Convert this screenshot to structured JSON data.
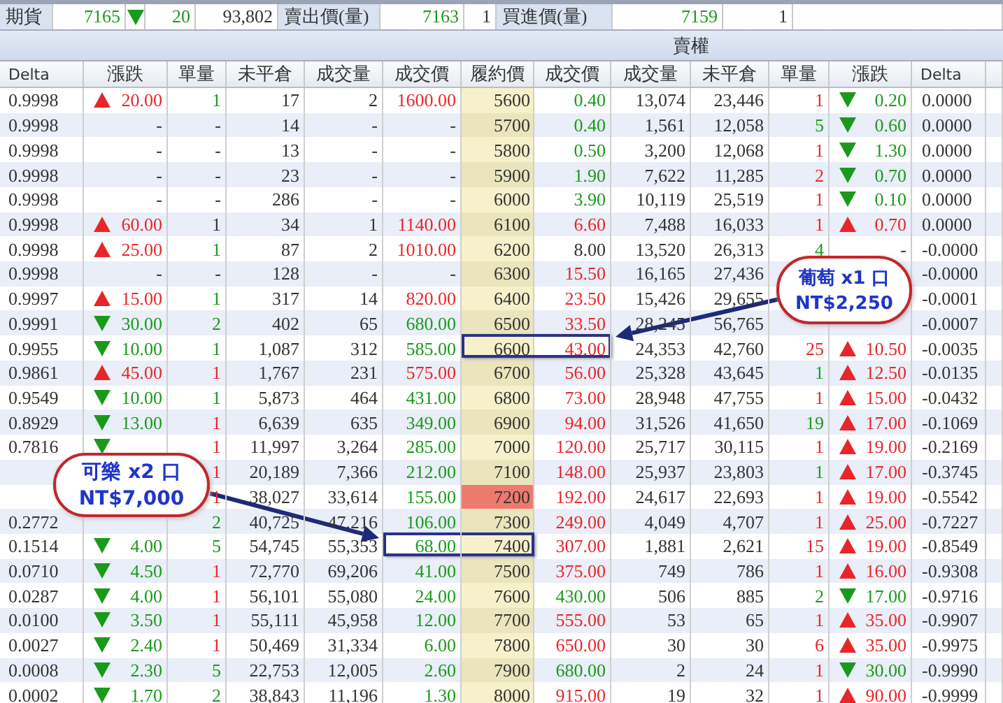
{
  "quote_bar": {
    "futures": {
      "label": "期貨",
      "price": {
        "text": "7165",
        "color": "#1a9a1a"
      },
      "change": {
        "kind": "down",
        "text": "20",
        "color": "#1a9a1a"
      },
      "volume": "93,802"
    },
    "ask": {
      "label": "賣出價(量)",
      "price": {
        "text": "7163",
        "color": "#1a9a1a"
      },
      "qty": "1"
    },
    "bid": {
      "label": "買進價(量)",
      "price": {
        "text": "7159",
        "color": "#1a9a1a"
      },
      "qty": "1"
    }
  },
  "section_header": "賣權",
  "columns": [
    "Delta",
    "漲跌",
    "單量",
    "未平倉",
    "成交量",
    "成交價",
    "履約價",
    "成交價",
    "成交量",
    "未平倉",
    "單量",
    "漲跌",
    "Delta"
  ],
  "rows": [
    {
      "strike": {
        "text": "5600",
        "atm": false
      },
      "call": {
        "delta": "0.9998",
        "change": {
          "kind": "up",
          "text": "20.00",
          "color": "#e8262a"
        },
        "qty": {
          "text": "1",
          "color": "#1a9a1a"
        },
        "oi": "17",
        "volume": "2",
        "price": {
          "text": "1600.00",
          "color": "#e8262a",
          "outlined": false
        }
      },
      "put": {
        "price": {
          "text": "0.40",
          "color": "#1a9a1a",
          "outlined": false
        },
        "volume": "13,074",
        "oi": "23,446",
        "qty": {
          "text": "1",
          "color": "#e8262a"
        },
        "change": {
          "kind": "down",
          "text": "0.20",
          "color": "#1a9a1a"
        },
        "delta": "0.0000"
      }
    },
    {
      "strike": {
        "text": "5700",
        "atm": false
      },
      "call": {
        "delta": "0.9998",
        "change": {
          "kind": "none",
          "text": "-",
          "color": "#333333"
        },
        "qty": {
          "text": "-",
          "color": "#333333"
        },
        "oi": "14",
        "volume": "-",
        "price": {
          "text": "-",
          "color": "#333333",
          "outlined": false
        }
      },
      "put": {
        "price": {
          "text": "0.40",
          "color": "#1a9a1a",
          "outlined": false
        },
        "volume": "1,561",
        "oi": "12,058",
        "qty": {
          "text": "5",
          "color": "#1a9a1a"
        },
        "change": {
          "kind": "down",
          "text": "0.60",
          "color": "#1a9a1a"
        },
        "delta": "0.0000"
      }
    },
    {
      "strike": {
        "text": "5800",
        "atm": false
      },
      "call": {
        "delta": "0.9998",
        "change": {
          "kind": "none",
          "text": "-",
          "color": "#333333"
        },
        "qty": {
          "text": "-",
          "color": "#333333"
        },
        "oi": "13",
        "volume": "-",
        "price": {
          "text": "-",
          "color": "#333333",
          "outlined": false
        }
      },
      "put": {
        "price": {
          "text": "0.50",
          "color": "#1a9a1a",
          "outlined": false
        },
        "volume": "3,200",
        "oi": "12,068",
        "qty": {
          "text": "1",
          "color": "#e8262a"
        },
        "change": {
          "kind": "down",
          "text": "1.30",
          "color": "#1a9a1a"
        },
        "delta": "0.0000"
      }
    },
    {
      "strike": {
        "text": "5900",
        "atm": false
      },
      "call": {
        "delta": "0.9998",
        "change": {
          "kind": "none",
          "text": "-",
          "color": "#333333"
        },
        "qty": {
          "text": "-",
          "color": "#333333"
        },
        "oi": "23",
        "volume": "-",
        "price": {
          "text": "-",
          "color": "#333333",
          "outlined": false
        }
      },
      "put": {
        "price": {
          "text": "1.90",
          "color": "#1a9a1a",
          "outlined": false
        },
        "volume": "7,622",
        "oi": "11,285",
        "qty": {
          "text": "2",
          "color": "#e8262a"
        },
        "change": {
          "kind": "down",
          "text": "0.70",
          "color": "#1a9a1a"
        },
        "delta": "0.0000"
      }
    },
    {
      "strike": {
        "text": "6000",
        "atm": false
      },
      "call": {
        "delta": "0.9998",
        "change": {
          "kind": "none",
          "text": "-",
          "color": "#333333"
        },
        "qty": {
          "text": "-",
          "color": "#333333"
        },
        "oi": "286",
        "volume": "-",
        "price": {
          "text": "-",
          "color": "#333333",
          "outlined": false
        }
      },
      "put": {
        "price": {
          "text": "3.90",
          "color": "#1a9a1a",
          "outlined": false
        },
        "volume": "10,119",
        "oi": "25,519",
        "qty": {
          "text": "1",
          "color": "#e8262a"
        },
        "change": {
          "kind": "down",
          "text": "0.10",
          "color": "#1a9a1a"
        },
        "delta": "0.0000"
      }
    },
    {
      "strike": {
        "text": "6100",
        "atm": false
      },
      "call": {
        "delta": "0.9998",
        "change": {
          "kind": "up",
          "text": "60.00",
          "color": "#e8262a"
        },
        "qty": {
          "text": "1",
          "color": "#333333"
        },
        "oi": "34",
        "volume": "1",
        "price": {
          "text": "1140.00",
          "color": "#e8262a",
          "outlined": false
        }
      },
      "put": {
        "price": {
          "text": "6.60",
          "color": "#e8262a",
          "outlined": false
        },
        "volume": "7,488",
        "oi": "16,033",
        "qty": {
          "text": "1",
          "color": "#e8262a"
        },
        "change": {
          "kind": "up",
          "text": "0.70",
          "color": "#e8262a"
        },
        "delta": "0.0000"
      }
    },
    {
      "strike": {
        "text": "6200",
        "atm": false
      },
      "call": {
        "delta": "0.9998",
        "change": {
          "kind": "up",
          "text": "25.00",
          "color": "#e8262a"
        },
        "qty": {
          "text": "1",
          "color": "#1a9a1a"
        },
        "oi": "87",
        "volume": "2",
        "price": {
          "text": "1010.00",
          "color": "#e8262a",
          "outlined": false
        }
      },
      "put": {
        "price": {
          "text": "8.00",
          "color": "#333333",
          "outlined": false
        },
        "volume": "13,520",
        "oi": "26,313",
        "qty": {
          "text": "4",
          "color": "#1a9a1a"
        },
        "change": {
          "kind": "none",
          "text": "-",
          "color": "#333333"
        },
        "delta": "-0.0000"
      }
    },
    {
      "strike": {
        "text": "6300",
        "atm": false
      },
      "call": {
        "delta": "0.9998",
        "change": {
          "kind": "none",
          "text": "-",
          "color": "#333333"
        },
        "qty": {
          "text": "-",
          "color": "#333333"
        },
        "oi": "128",
        "volume": "-",
        "price": {
          "text": "-",
          "color": "#333333",
          "outlined": false
        }
      },
      "put": {
        "price": {
          "text": "15.50",
          "color": "#e8262a",
          "outlined": false
        },
        "volume": "16,165",
        "oi": "27,436",
        "delta": "-0.0000"
      }
    },
    {
      "strike": {
        "text": "6400",
        "atm": false
      },
      "call": {
        "delta": "0.9997",
        "change": {
          "kind": "up",
          "text": "15.00",
          "color": "#e8262a"
        },
        "qty": {
          "text": "1",
          "color": "#1a9a1a"
        },
        "oi": "317",
        "volume": "14",
        "price": {
          "text": "820.00",
          "color": "#e8262a",
          "outlined": false
        }
      },
      "put": {
        "price": {
          "text": "23.50",
          "color": "#e8262a",
          "outlined": false
        },
        "volume": "15,426",
        "oi": "29,655",
        "delta": "-0.0001"
      }
    },
    {
      "strike": {
        "text": "6500",
        "atm": false
      },
      "call": {
        "delta": "0.9991",
        "change": {
          "kind": "down",
          "text": "30.00",
          "color": "#1a9a1a"
        },
        "qty": {
          "text": "2",
          "color": "#1a9a1a"
        },
        "oi": "402",
        "volume": "65",
        "price": {
          "text": "680.00",
          "color": "#1a9a1a",
          "outlined": false
        }
      },
      "put": {
        "price": {
          "text": "33.50",
          "color": "#e8262a",
          "outlined": false
        },
        "volume": "28,245",
        "oi": "56,765",
        "delta": "-0.0007"
      }
    },
    {
      "strike": {
        "text": "6600",
        "atm": false
      },
      "call": {
        "delta": "0.9955",
        "change": {
          "kind": "down",
          "text": "10.00",
          "color": "#1a9a1a"
        },
        "qty": {
          "text": "1",
          "color": "#1a9a1a"
        },
        "oi": "1,087",
        "volume": "312",
        "price": {
          "text": "585.00",
          "color": "#1a9a1a",
          "outlined": false
        }
      },
      "put": {
        "price": {
          "text": "43.00",
          "color": "#e8262a",
          "outlined": true
        },
        "volume": "24,353",
        "oi": "42,760",
        "qty": {
          "text": "25",
          "color": "#e8262a"
        },
        "change": {
          "kind": "up",
          "text": "10.50",
          "color": "#e8262a"
        },
        "delta": "-0.0035"
      }
    },
    {
      "strike": {
        "text": "6700",
        "atm": false
      },
      "call": {
        "delta": "0.9861",
        "change": {
          "kind": "up",
          "text": "45.00",
          "color": "#e8262a"
        },
        "qty": {
          "text": "1",
          "color": "#e8262a"
        },
        "oi": "1,767",
        "volume": "231",
        "price": {
          "text": "575.00",
          "color": "#e8262a",
          "outlined": false
        }
      },
      "put": {
        "price": {
          "text": "56.00",
          "color": "#e8262a",
          "outlined": false
        },
        "volume": "25,328",
        "oi": "43,645",
        "qty": {
          "text": "1",
          "color": "#1a9a1a"
        },
        "change": {
          "kind": "up",
          "text": "12.50",
          "color": "#e8262a"
        },
        "delta": "-0.0135"
      }
    },
    {
      "strike": {
        "text": "6800",
        "atm": false
      },
      "call": {
        "delta": "0.9549",
        "change": {
          "kind": "down",
          "text": "10.00",
          "color": "#1a9a1a"
        },
        "qty": {
          "text": "1",
          "color": "#1a9a1a"
        },
        "oi": "5,873",
        "volume": "464",
        "price": {
          "text": "431.00",
          "color": "#1a9a1a",
          "outlined": false
        }
      },
      "put": {
        "price": {
          "text": "73.00",
          "color": "#e8262a",
          "outlined": false
        },
        "volume": "28,948",
        "oi": "47,755",
        "qty": {
          "text": "1",
          "color": "#e8262a"
        },
        "change": {
          "kind": "up",
          "text": "15.00",
          "color": "#e8262a"
        },
        "delta": "-0.0432"
      }
    },
    {
      "strike": {
        "text": "6900",
        "atm": false
      },
      "call": {
        "delta": "0.8929",
        "change": {
          "kind": "down",
          "text": "13.00",
          "color": "#1a9a1a"
        },
        "qty": {
          "text": "1",
          "color": "#e8262a"
        },
        "oi": "6,639",
        "volume": "635",
        "price": {
          "text": "349.00",
          "color": "#1a9a1a",
          "outlined": false
        }
      },
      "put": {
        "price": {
          "text": "94.00",
          "color": "#e8262a",
          "outlined": false
        },
        "volume": "31,526",
        "oi": "41,650",
        "qty": {
          "text": "19",
          "color": "#1a9a1a"
        },
        "change": {
          "kind": "up",
          "text": "17.00",
          "color": "#e8262a"
        },
        "delta": "-0.1069"
      }
    },
    {
      "strike": {
        "text": "7000",
        "atm": false
      },
      "call": {
        "delta": "0.7816",
        "change": {
          "kind": "down",
          "color": "#1a9a1a"
        },
        "qty": {
          "text": "1",
          "color": "#e8262a"
        },
        "oi": "11,997",
        "volume": "3,264",
        "price": {
          "text": "285.00",
          "color": "#1a9a1a",
          "outlined": false
        }
      },
      "put": {
        "price": {
          "text": "120.00",
          "color": "#e8262a",
          "outlined": false
        },
        "volume": "25,717",
        "oi": "30,115",
        "qty": {
          "text": "1",
          "color": "#e8262a"
        },
        "change": {
          "kind": "up",
          "text": "19.00",
          "color": "#e8262a"
        },
        "delta": "-0.2169"
      }
    },
    {
      "strike": {
        "text": "7100",
        "atm": false
      },
      "call": {
        "qty": {
          "text": "1",
          "color": "#e8262a"
        },
        "oi": "20,189",
        "volume": "7,366",
        "price": {
          "text": "212.00",
          "color": "#1a9a1a",
          "outlined": false
        }
      },
      "put": {
        "price": {
          "text": "148.00",
          "color": "#e8262a",
          "outlined": false
        },
        "volume": "25,937",
        "oi": "23,803",
        "qty": {
          "text": "1",
          "color": "#1a9a1a"
        },
        "change": {
          "kind": "up",
          "text": "17.00",
          "color": "#e8262a"
        },
        "delta": "-0.3745"
      }
    },
    {
      "strike": {
        "text": "7200",
        "atm": true
      },
      "call": {
        "qty": {
          "text": "1",
          "color": "#e8262a"
        },
        "oi": "38,027",
        "volume": "33,614",
        "price": {
          "text": "155.00",
          "color": "#1a9a1a",
          "outlined": false
        }
      },
      "put": {
        "price": {
          "text": "192.00",
          "color": "#e8262a",
          "outlined": false
        },
        "volume": "24,617",
        "oi": "22,693",
        "qty": {
          "text": "1",
          "color": "#e8262a"
        },
        "change": {
          "kind": "up",
          "text": "19.00",
          "color": "#e8262a"
        },
        "delta": "-0.5542"
      }
    },
    {
      "strike": {
        "text": "7300",
        "atm": false
      },
      "call": {
        "delta": "0.2772",
        "qty": {
          "text": "2",
          "color": "#1a9a1a"
        },
        "oi": "40,725",
        "volume": "47,216",
        "price": {
          "text": "106.00",
          "color": "#1a9a1a",
          "outlined": false
        }
      },
      "put": {
        "price": {
          "text": "249.00",
          "color": "#e8262a",
          "outlined": false
        },
        "volume": "4,049",
        "oi": "4,707",
        "qty": {
          "text": "1",
          "color": "#e8262a"
        },
        "change": {
          "kind": "up",
          "text": "25.00",
          "color": "#e8262a"
        },
        "delta": "-0.7227"
      }
    },
    {
      "strike": {
        "text": "7400",
        "atm": false
      },
      "call": {
        "delta": "0.1514",
        "change": {
          "kind": "down",
          "text": "4.00",
          "color": "#1a9a1a"
        },
        "qty": {
          "text": "5",
          "color": "#1a9a1a"
        },
        "oi": "54,745",
        "volume": "55,353",
        "price": {
          "text": "68.00",
          "color": "#1a9a1a",
          "outlined": true
        }
      },
      "put": {
        "price": {
          "text": "307.00",
          "color": "#e8262a",
          "outlined": false
        },
        "volume": "1,881",
        "oi": "2,621",
        "qty": {
          "text": "15",
          "color": "#e8262a"
        },
        "change": {
          "kind": "up",
          "text": "19.00",
          "color": "#e8262a"
        },
        "delta": "-0.8549"
      }
    },
    {
      "strike": {
        "text": "7500",
        "atm": false
      },
      "call": {
        "delta": "0.0710",
        "change": {
          "kind": "down",
          "text": "4.50",
          "color": "#1a9a1a"
        },
        "qty": {
          "text": "1",
          "color": "#e8262a"
        },
        "oi": "72,770",
        "volume": "69,206",
        "price": {
          "text": "41.00",
          "color": "#1a9a1a",
          "outlined": false
        }
      },
      "put": {
        "price": {
          "text": "375.00",
          "color": "#e8262a",
          "outlined": false
        },
        "volume": "749",
        "oi": "786",
        "qty": {
          "text": "1",
          "color": "#e8262a"
        },
        "change": {
          "kind": "up",
          "text": "16.00",
          "color": "#e8262a"
        },
        "delta": "-0.9308"
      }
    },
    {
      "strike": {
        "text": "7600",
        "atm": false
      },
      "call": {
        "delta": "0.0287",
        "change": {
          "kind": "down",
          "text": "4.00",
          "color": "#1a9a1a"
        },
        "qty": {
          "text": "1",
          "color": "#e8262a"
        },
        "oi": "56,101",
        "volume": "55,080",
        "price": {
          "text": "24.00",
          "color": "#1a9a1a",
          "outlined": false
        }
      },
      "put": {
        "price": {
          "text": "430.00",
          "color": "#1a9a1a",
          "outlined": false
        },
        "volume": "506",
        "oi": "885",
        "qty": {
          "text": "2",
          "color": "#1a9a1a"
        },
        "change": {
          "kind": "down",
          "text": "17.00",
          "color": "#1a9a1a"
        },
        "delta": "-0.9716"
      }
    },
    {
      "strike": {
        "text": "7700",
        "atm": false
      },
      "call": {
        "delta": "0.0100",
        "change": {
          "kind": "down",
          "text": "3.50",
          "color": "#1a9a1a"
        },
        "qty": {
          "text": "1",
          "color": "#e8262a"
        },
        "oi": "55,111",
        "volume": "45,958",
        "price": {
          "text": "12.00",
          "color": "#1a9a1a",
          "outlined": false
        }
      },
      "put": {
        "price": {
          "text": "555.00",
          "color": "#e8262a",
          "outlined": false
        },
        "volume": "53",
        "oi": "65",
        "qty": {
          "text": "1",
          "color": "#e8262a"
        },
        "change": {
          "kind": "up",
          "text": "35.00",
          "color": "#e8262a"
        },
        "delta": "-0.9907"
      }
    },
    {
      "strike": {
        "text": "7800",
        "atm": false
      },
      "call": {
        "delta": "0.0027",
        "change": {
          "kind": "down",
          "text": "2.40",
          "color": "#1a9a1a"
        },
        "qty": {
          "text": "1",
          "color": "#e8262a"
        },
        "oi": "50,469",
        "volume": "31,334",
        "price": {
          "text": "6.00",
          "color": "#1a9a1a",
          "outlined": false
        }
      },
      "put": {
        "price": {
          "text": "650.00",
          "color": "#e8262a",
          "outlined": false
        },
        "volume": "30",
        "oi": "30",
        "qty": {
          "text": "6",
          "color": "#e8262a"
        },
        "change": {
          "kind": "up",
          "text": "35.00",
          "color": "#e8262a"
        },
        "delta": "-0.9975"
      }
    },
    {
      "strike": {
        "text": "7900",
        "atm": false
      },
      "call": {
        "delta": "0.0008",
        "change": {
          "kind": "down",
          "text": "2.30",
          "color": "#1a9a1a"
        },
        "qty": {
          "text": "5",
          "color": "#1a9a1a"
        },
        "oi": "22,753",
        "volume": "12,005",
        "price": {
          "text": "2.60",
          "color": "#1a9a1a",
          "outlined": false
        }
      },
      "put": {
        "price": {
          "text": "680.00",
          "color": "#1a9a1a",
          "outlined": false
        },
        "volume": "2",
        "oi": "24",
        "qty": {
          "text": "1",
          "color": "#e8262a"
        },
        "change": {
          "kind": "down",
          "text": "30.00",
          "color": "#1a9a1a"
        },
        "delta": "-0.9990"
      }
    },
    {
      "strike": {
        "text": "8000",
        "atm": false
      },
      "call": {
        "delta": "0.0002",
        "change": {
          "kind": "down",
          "text": "1.70",
          "color": "#1a9a1a"
        },
        "qty": {
          "text": "2",
          "color": "#1a9a1a"
        },
        "oi": "38,843",
        "volume": "11,196",
        "price": {
          "text": "1.30",
          "color": "#1a9a1a",
          "outlined": false
        }
      },
      "put": {
        "price": {
          "text": "915.00",
          "color": "#e8262a",
          "outlined": false
        },
        "volume": "19",
        "oi": "32",
        "qty": {
          "text": "1",
          "color": "#e8262a"
        },
        "change": {
          "kind": "up",
          "text": "90.00",
          "color": "#e8262a"
        },
        "delta": "-0.9999"
      }
    }
  ],
  "callouts": [
    {
      "line_1": "葡萄 x1 口",
      "line_2": "NT$2,250"
    },
    {
      "line_1": "可樂 x2 口",
      "line_2": "NT$7,000"
    }
  ]
}
